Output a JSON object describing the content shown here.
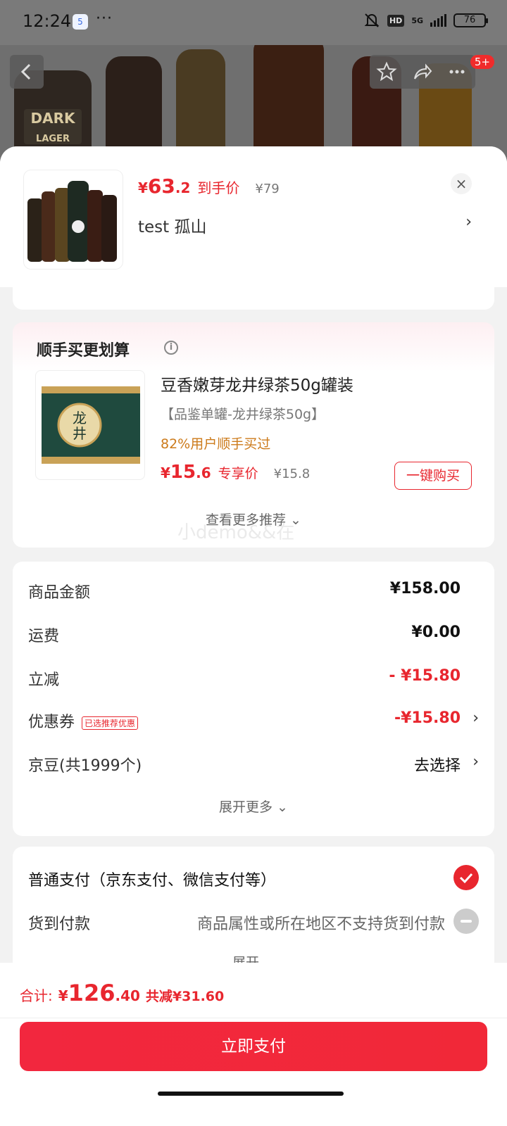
{
  "status_bar": {
    "time": "12:24",
    "app_icon_text": "5",
    "more": "···",
    "hd": "HD",
    "network": "5G",
    "battery": "76"
  },
  "background": {
    "bottle_label": "DARK",
    "bottle_sub": "LAGER"
  },
  "nav": {
    "badge": "5+"
  },
  "product": {
    "price_symbol": "¥",
    "price_int": "63",
    "price_dec": ".2",
    "price_tag": "到手价",
    "original_price": "¥79",
    "spec": "test   孤山",
    "spec_arrow": "›",
    "close": "×"
  },
  "recommend": {
    "title": "顺手买更划算",
    "info": "i",
    "item_name": "豆香嫩芽龙井绿茶50g罐装",
    "item_spec": "【品鉴单罐-龙井绿茶50g】",
    "item_buy_rate": "82%用户顺手买过",
    "price_symbol": "¥",
    "price_int": "15",
    "price_dec": ".6",
    "price_tag": "专享价",
    "original_price": "¥15.8",
    "buy_button": "一键购买",
    "more": "查看更多推荐 ⌄",
    "tea_label": "龙井"
  },
  "watermark": "小demo&&在",
  "fees": {
    "goods_label": "商品金额",
    "goods_value": "¥158.00",
    "ship_label": "运费",
    "ship_value": "¥0.00",
    "discount_label": "立减",
    "discount_value": "- ¥15.80",
    "coupon_label": "优惠券",
    "coupon_tag": "已选推荐优惠",
    "coupon_value": "-¥15.80",
    "jd_label": "京豆(共1999个)",
    "jd_value": "去选择",
    "chevron": "›",
    "more": "展开更多 ⌄"
  },
  "payment": {
    "normal": "普通支付（京东支付、微信支付等）",
    "cod_label": "货到付款",
    "cod_note": "商品属性或所在地区不支持货到付款",
    "expand": "展开 ⌄"
  },
  "footer": {
    "total_label": "合计:",
    "symbol": "¥",
    "total_int": "126",
    "total_dec": ".40",
    "saved": "共减¥31.60",
    "pay_button": "立即支付"
  },
  "colors": {
    "accent": "#e8262e",
    "pay_button": "#f2273e",
    "buy_rate": "#cc7a1a"
  }
}
